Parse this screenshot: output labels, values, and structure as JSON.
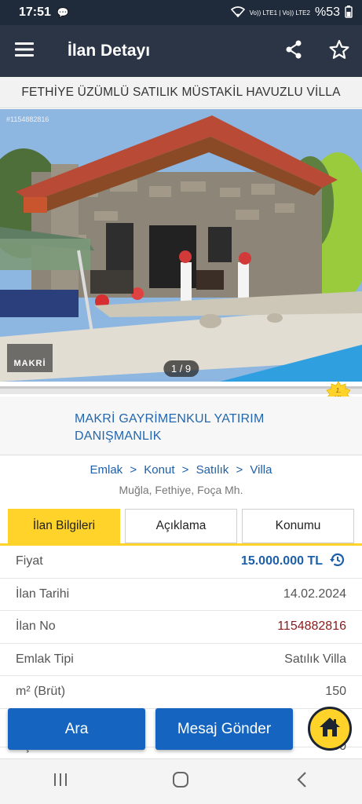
{
  "status_bar": {
    "time": "17:51",
    "network": "Vo)) LTE1 | Vo)) LTE2",
    "battery": "%53"
  },
  "app_bar": {
    "title": "İlan Detayı",
    "icons": [
      "menu-icon",
      "share-icon",
      "star-icon"
    ]
  },
  "listing": {
    "title": "FETHİYE ÜZÜMLÜ SATILIK MÜSTAKİL HAVUZLU VİLLA",
    "photo_id_tag": "#1154882816",
    "photo_counter": "1 / 9",
    "watermark": "MAKRİ"
  },
  "year_badge": "1. YIL",
  "agency": {
    "name": "MAKRİ GAYRİMENKUL YATIRIM DANIŞMANLIK"
  },
  "breadcrumb": [
    "Emlak",
    "Konut",
    "Satılık",
    "Villa"
  ],
  "breadcrumb_separator": ">",
  "location": "Muğla, Fethiye, Foça Mh.",
  "tabs": [
    {
      "label": "İlan Bilgileri",
      "active": true
    },
    {
      "label": "Açıklama",
      "active": false
    },
    {
      "label": "Konumu",
      "active": false
    }
  ],
  "info": [
    {
      "label": "Fiyat",
      "value": "15.000.000 TL"
    },
    {
      "label": "İlan Tarihi",
      "value": "14.02.2024"
    },
    {
      "label": "İlan No",
      "value": "1154882816"
    },
    {
      "label": "Emlak Tipi",
      "value": "Satılık Villa"
    },
    {
      "label": "m² (Brüt)",
      "value": "150"
    },
    {
      "label": "Açık Alan m²",
      "value": "500"
    }
  ],
  "actions": {
    "call_label": "Ara",
    "message_label": "Mesaj Gönder"
  },
  "colors": {
    "app_bar": "#2b3546",
    "accent_yellow": "#ffd32a",
    "primary_blue": "#1565c0",
    "link_blue": "#1e5fa8",
    "listing_no_red": "#8b1a1a"
  }
}
